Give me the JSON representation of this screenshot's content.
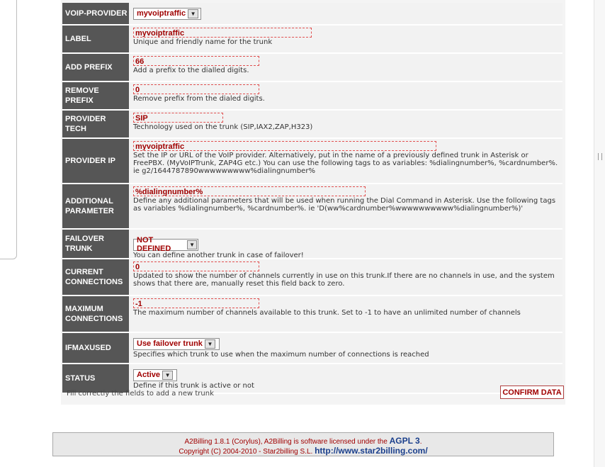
{
  "form": {
    "rows": [
      {
        "label": "VOIP-PROVIDER",
        "select": "myvoiptraffic"
      },
      {
        "label": "LABEL",
        "value": "myvoiptraffic",
        "desc": "Unique and friendly name for the trunk"
      },
      {
        "label": "ADD PREFIX",
        "value": "66",
        "desc": "Add a prefix to the dialled digits."
      },
      {
        "label": "REMOVE PREFIX",
        "value": "0",
        "desc": "Remove prefix from the dialed digits."
      },
      {
        "label": "PROVIDER TECH",
        "value": "SIP",
        "desc": "Technology used on the trunk (SIP,IAX2,ZAP,H323)"
      },
      {
        "label": "PROVIDER IP",
        "value": "myvoiptraffic",
        "desc": "Set the IP or URL of the VoIP provider. Alternatively, put in the name of a previously defined trunk in Asterisk or FreePBX. (MyVoIPTrunk, ZAP4G etc.) You can use the following tags to as variables: %dialingnumber%, %cardnumber%. ie g2/1644787890wwwwwwwww%dialingnumber%"
      },
      {
        "label": "ADDITIONAL PARAMETER",
        "value": "%dialingnumber%",
        "desc": "Define any additional parameters that will be used when running the Dial Command in Asterisk. Use the following tags as variables %dialingnumber%, %cardnumber%. ie 'D(ww%cardnumber%wwwwwwwwww%dialingnumber%)'"
      },
      {
        "label": "FAILOVER TRUNK",
        "select": "NOT DEFINED",
        "desc": "You can define another trunk in case of failover!"
      },
      {
        "label": "CURRENT CONNECTIONS",
        "value": "0",
        "desc": "Updated to show the number of channels currently in use on this trunk.If there are no channels in use, and the system shows that there are, manually reset this field back to zero."
      },
      {
        "label": "MAXIMUM CONNECTIONS",
        "value": "-1",
        "desc": "The maximum number of channels available to this trunk. Set to -1 to have an unlimited number of channels"
      },
      {
        "label": "IFMAXUSED",
        "select": "Use failover trunk",
        "desc": "Specifies which trunk to use when the maximum number of connections is reached"
      },
      {
        "label": "STATUS",
        "select": "Active",
        "desc": "Define if this trunk is active or not"
      }
    ],
    "footer_hint": "Fill correctly the fields to add a new trunk",
    "confirm_label": "CONFIRM DATA"
  },
  "site_footer": {
    "line1_text": "A2Billing 1.8.1 (Corylus), A2Billing is software licensed under the",
    "line1_link": "AGPL 3",
    "line1_end": ".",
    "line2_text": "Copyright (C) 2004-2010 - Star2billing S.L.",
    "line2_link": "http://www.star2billing.com/"
  },
  "colors": {
    "label_bg": "#565656",
    "accent_red": "#a00000",
    "link_blue": "#1a3f8c"
  }
}
